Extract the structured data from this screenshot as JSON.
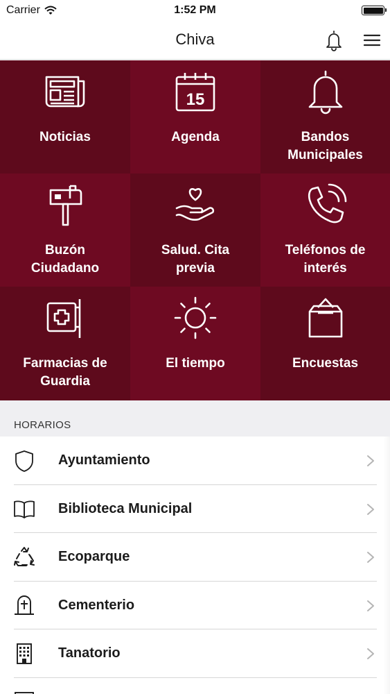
{
  "status_bar": {
    "carrier": "Carrier",
    "time": "1:52 PM"
  },
  "nav": {
    "title": "Chiva",
    "bell_icon": "bell-icon",
    "menu_icon": "hamburger-menu-icon"
  },
  "tiles": [
    {
      "label": "Noticias",
      "icon": "newspaper-icon"
    },
    {
      "label": "Agenda",
      "icon": "calendar-icon",
      "icon_text": "15"
    },
    {
      "label": "Bandos\nMunicipales",
      "icon": "bell-icon"
    },
    {
      "label": "Buzón\nCiudadano",
      "icon": "mailbox-icon"
    },
    {
      "label": "Salud. Cita\nprevia",
      "icon": "heart-hand-icon"
    },
    {
      "label": "Teléfonos de\ninterés",
      "icon": "phone-icon"
    },
    {
      "label": "Farmacias de\nGuardia",
      "icon": "pharmacy-cross-icon"
    },
    {
      "label": "El tiempo",
      "icon": "sun-icon"
    },
    {
      "label": "Encuestas",
      "icon": "ballot-box-icon"
    }
  ],
  "colors": {
    "tile_dark": "#5e0a1c",
    "tile_mid": "#6e0a22",
    "section_bg": "#efeff2"
  },
  "section": {
    "title": "HORARIOS"
  },
  "horarios": [
    {
      "label": "Ayuntamiento",
      "icon": "shield-icon"
    },
    {
      "label": "Biblioteca Municipal",
      "icon": "open-book-icon"
    },
    {
      "label": "Ecoparque",
      "icon": "recycle-icon"
    },
    {
      "label": "Cementerio",
      "icon": "tombstone-cross-icon"
    },
    {
      "label": "Tanatorio",
      "icon": "building-icon"
    }
  ]
}
